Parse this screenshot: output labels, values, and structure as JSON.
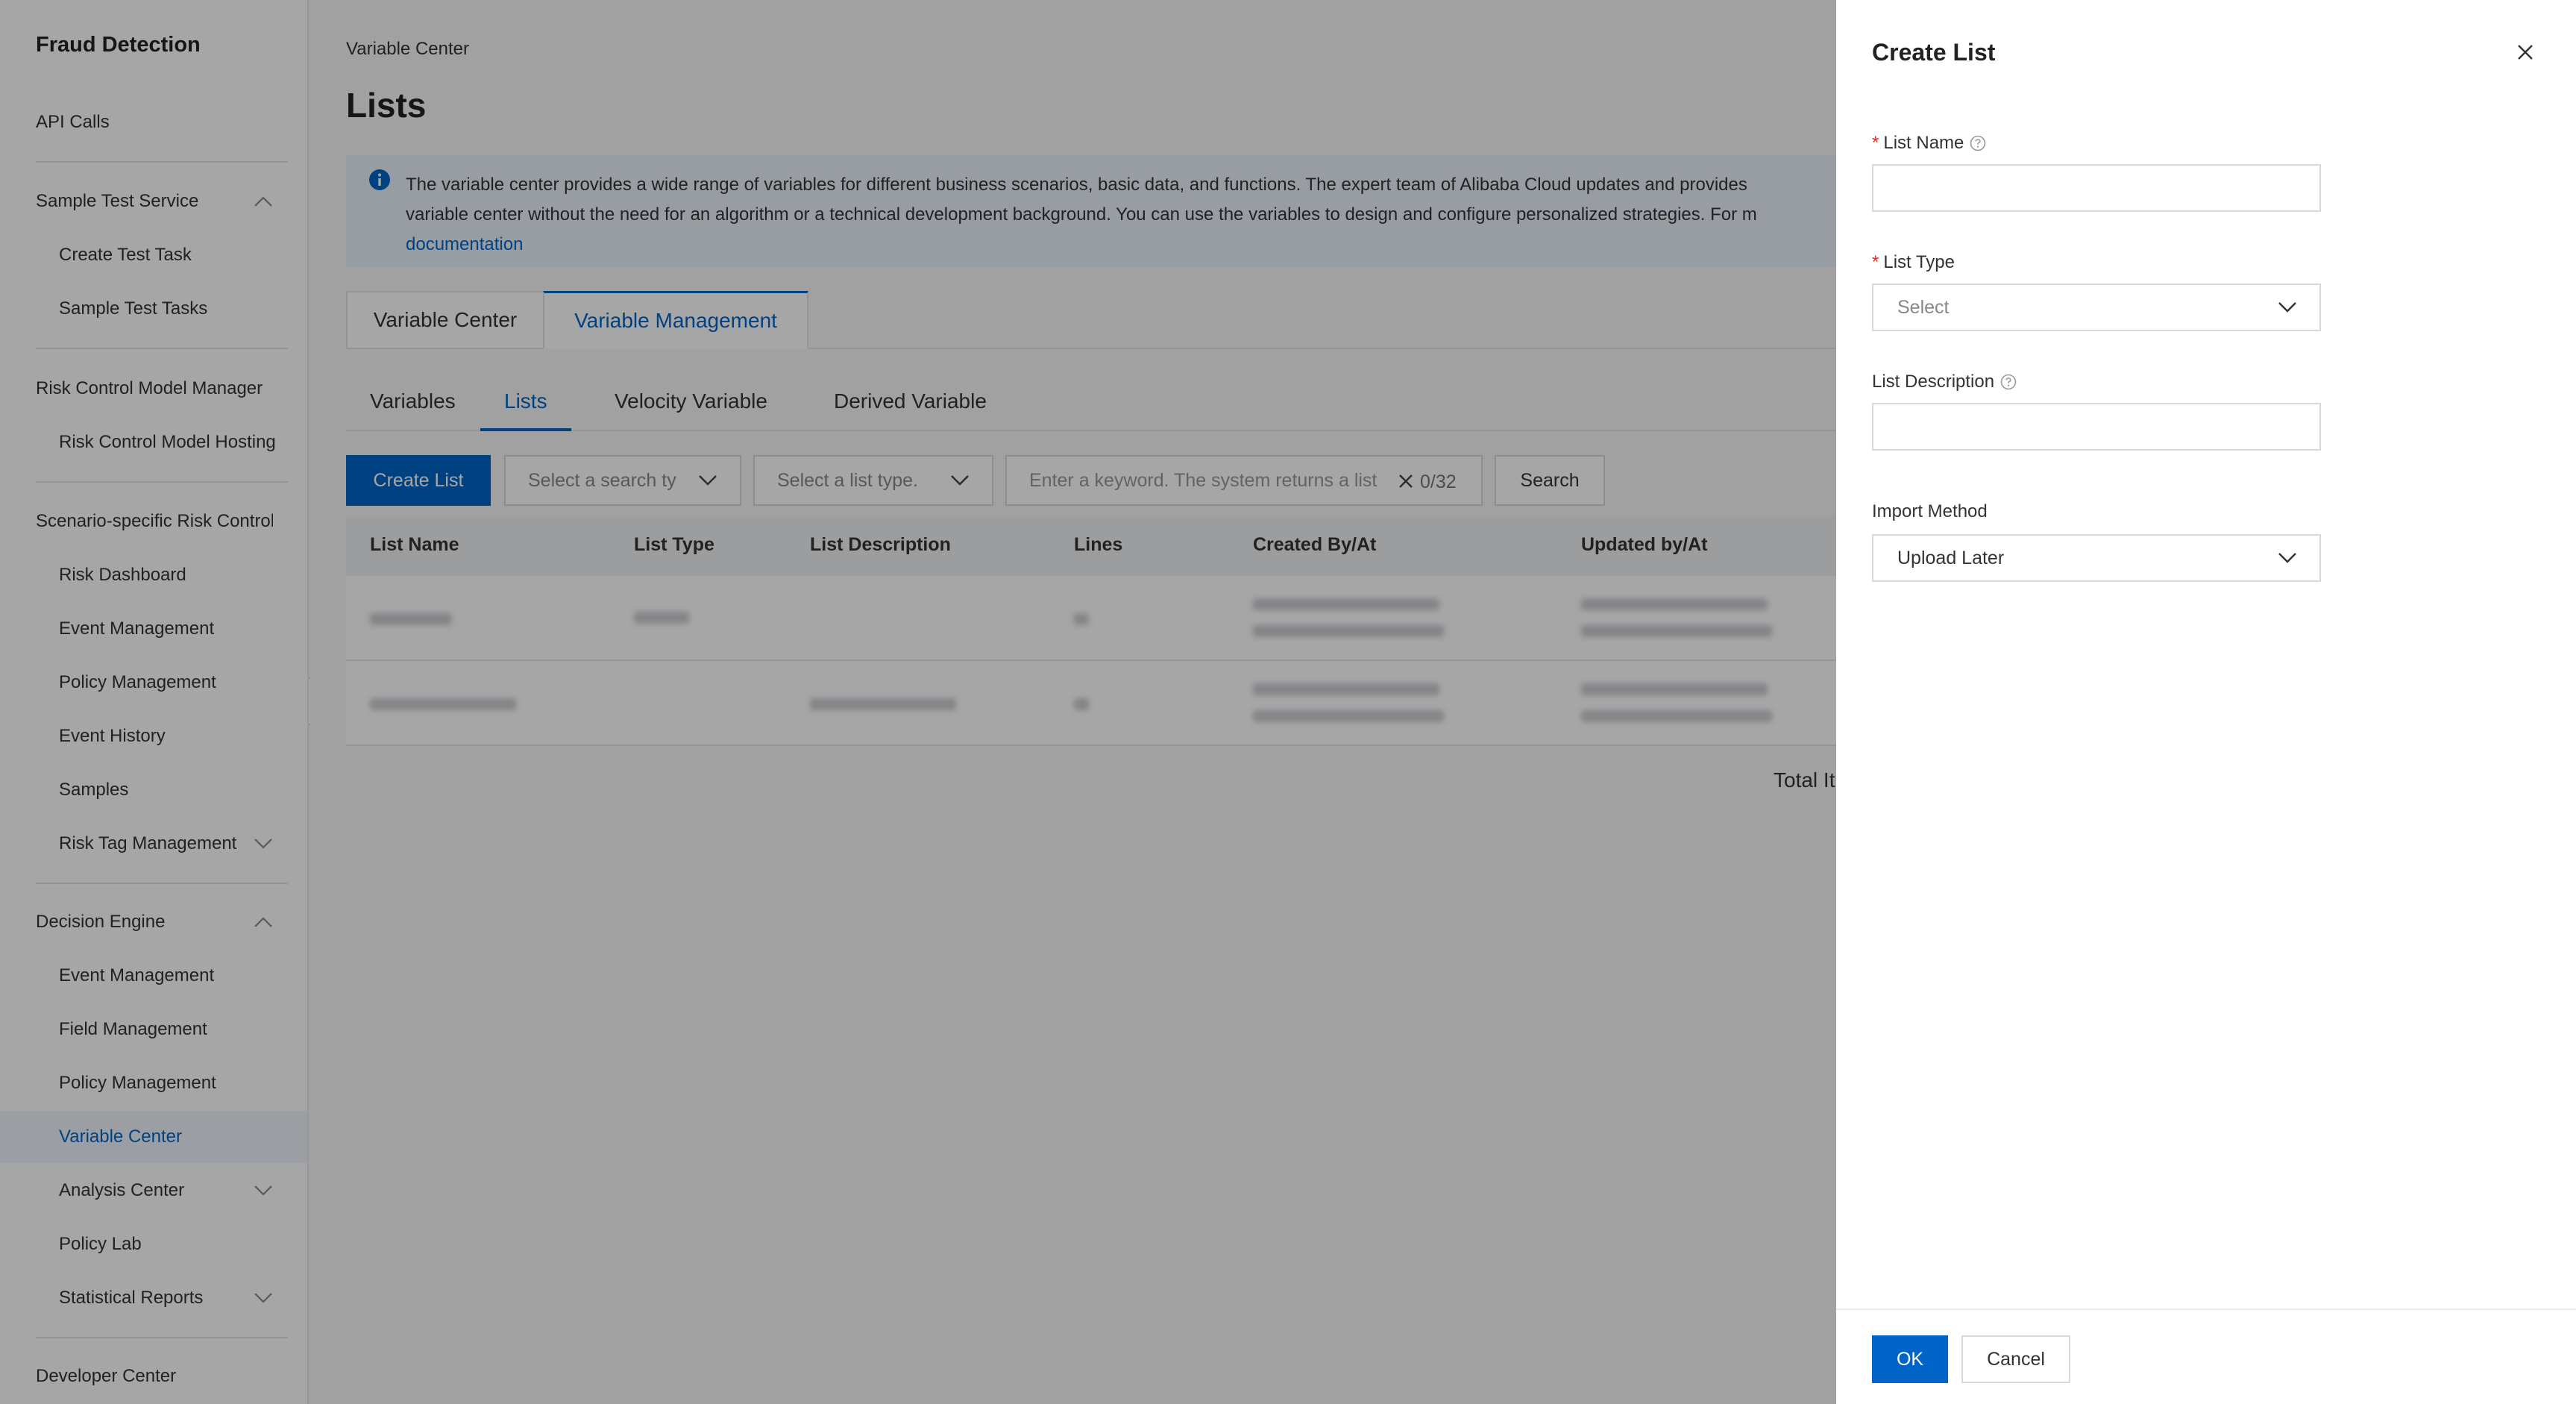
{
  "sidebar": {
    "title": "Fraud Detection",
    "items": {
      "api_calls": "API Calls",
      "sample_test_service": "Sample Test Service",
      "create_test_task": "Create Test Task",
      "sample_test_tasks": "Sample Test Tasks",
      "risk_control_model_manager": "Risk Control Model Manager",
      "risk_control_model_hosting": "Risk Control Model Hosting",
      "scenario_specific_risk_control": "Scenario-specific Risk Control",
      "risk_dashboard": "Risk Dashboard",
      "event_management": "Event Management",
      "policy_management": "Policy Management",
      "event_history": "Event History",
      "samples": "Samples",
      "risk_tag_management": "Risk Tag Management",
      "decision_engine": "Decision Engine",
      "de_event_management": "Event Management",
      "field_management": "Field Management",
      "de_policy_management": "Policy Management",
      "variable_center": "Variable Center",
      "analysis_center": "Analysis Center",
      "policy_lab": "Policy Lab",
      "statistical_reports": "Statistical Reports",
      "developer_center": "Developer Center"
    }
  },
  "main": {
    "breadcrumb": "Variable Center",
    "title": "Lists",
    "notice": {
      "line1": "The variable center provides a wide range of variables for different business scenarios, basic data, and functions. The expert team of Alibaba Cloud updates and provides",
      "line2": "variable center without the need for an algorithm or a technical development background. You can use the variables to design and configure personalized strategies. For m",
      "link": "documentation"
    },
    "outer_tabs": [
      "Variable Center",
      "Variable Management"
    ],
    "inner_tabs": [
      "Variables",
      "Lists",
      "Velocity Variable",
      "Derived Variable"
    ],
    "toolbar": {
      "create_list": "Create List",
      "search_type_placeholder": "Select a search type",
      "list_type_placeholder": "Select a list type.",
      "keyword_placeholder": "Enter a keyword. The system returns a list",
      "keyword_count": "0/32",
      "search": "Search"
    },
    "table": {
      "headers": [
        "List Name",
        "List Type",
        "List Description",
        "Lines",
        "Created By/At",
        "Updated by/At"
      ]
    },
    "total": "Total It"
  },
  "drawer": {
    "title": "Create List",
    "list_name_label": "List Name",
    "list_type_label": "List Type",
    "list_type_placeholder": "Select",
    "list_description_label": "List Description",
    "import_method_label": "Import Method",
    "import_method_value": "Upload Later",
    "ok": "OK",
    "cancel": "Cancel"
  },
  "colors": {
    "brand": "#0064c8",
    "required": "#d93026"
  }
}
